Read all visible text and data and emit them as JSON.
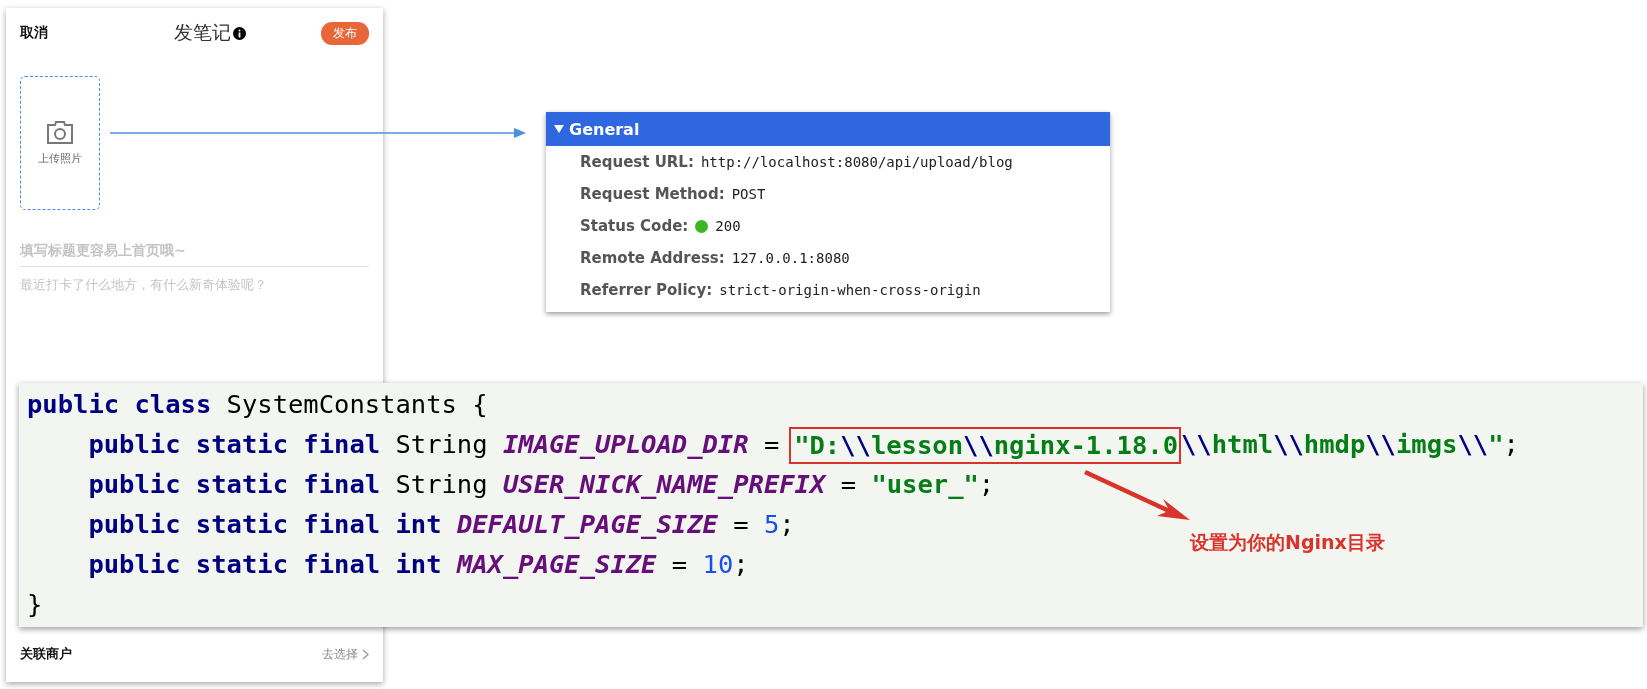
{
  "phone_form": {
    "cancel": "取消",
    "title": "发笔记",
    "publish": "发布",
    "upload": {
      "label": "上传照片"
    },
    "title_field": {
      "placeholder": "填写标题更容易上首页哦~"
    },
    "body_field": {
      "placeholder": "最近打卡了什么地方，有什么新奇体验呢？"
    },
    "merchant_row": {
      "label": "关联商户",
      "action": "去选择"
    }
  },
  "network_panel": {
    "section": {
      "title": "General",
      "expanded": true
    },
    "rows": [
      {
        "label": "Request URL:",
        "value": "http://localhost:8080/api/upload/blog"
      },
      {
        "label": "Request Method:",
        "value": "POST"
      },
      {
        "label": "Status Code:",
        "value": "200",
        "color": "#3cb521"
      },
      {
        "label": "Remote Address:",
        "value": "127.0.0.1:8080"
      },
      {
        "label": "Referrer Policy:",
        "value": "strict-origin-when-cross-origin"
      }
    ]
  },
  "code": {
    "lines": [
      {
        "indented": false,
        "tokens": [
          {
            "kind": "keyword",
            "text": "public class "
          },
          {
            "kind": "plain",
            "text": "SystemConstants {"
          }
        ]
      },
      {
        "indented": true,
        "tokens": [
          {
            "kind": "keyword",
            "text": "public static final "
          },
          {
            "kind": "plain",
            "text": "String "
          },
          {
            "kind": "constant",
            "text": "IMAGE_UPLOAD_DIR"
          },
          {
            "kind": "plain",
            "text": " = "
          },
          {
            "kind": "string",
            "text": "\"D:",
            "boxed": true
          },
          {
            "kind": "escape",
            "text": "\\\\",
            "boxed": true
          },
          {
            "kind": "string",
            "text": "lesson",
            "boxed": true
          },
          {
            "kind": "escape",
            "text": "\\\\",
            "boxed": true
          },
          {
            "kind": "string",
            "text": "nginx-1.18.0",
            "boxed": true
          },
          {
            "kind": "escape",
            "text": "\\\\"
          },
          {
            "kind": "string",
            "text": "html"
          },
          {
            "kind": "escape",
            "text": "\\\\"
          },
          {
            "kind": "string",
            "text": "hmdp"
          },
          {
            "kind": "escape",
            "text": "\\\\"
          },
          {
            "kind": "string",
            "text": "imgs"
          },
          {
            "kind": "escape",
            "text": "\\\\"
          },
          {
            "kind": "string",
            "text": "\""
          },
          {
            "kind": "plain",
            "text": ";"
          }
        ]
      },
      {
        "indented": true,
        "tokens": [
          {
            "kind": "keyword",
            "text": "public static final "
          },
          {
            "kind": "plain",
            "text": "String "
          },
          {
            "kind": "constant",
            "text": "USER_NICK_NAME_PREFIX"
          },
          {
            "kind": "plain",
            "text": " = "
          },
          {
            "kind": "string",
            "text": "\"user_\""
          },
          {
            "kind": "plain",
            "text": ";"
          }
        ]
      },
      {
        "indented": true,
        "tokens": [
          {
            "kind": "keyword",
            "text": "public static final int "
          },
          {
            "kind": "constant",
            "text": "DEFAULT_PAGE_SIZE"
          },
          {
            "kind": "plain",
            "text": " = "
          },
          {
            "kind": "number",
            "text": "5"
          },
          {
            "kind": "plain",
            "text": ";"
          }
        ]
      },
      {
        "indented": true,
        "tokens": [
          {
            "kind": "keyword",
            "text": "public static final int "
          },
          {
            "kind": "constant",
            "text": "MAX_PAGE_SIZE"
          },
          {
            "kind": "plain",
            "text": " = "
          },
          {
            "kind": "number",
            "text": "10"
          },
          {
            "kind": "plain",
            "text": ";"
          }
        ]
      },
      {
        "indented": false,
        "tokens": [
          {
            "kind": "plain",
            "text": "}"
          }
        ]
      }
    ]
  },
  "annotation": {
    "text": "设置为你的Nginx目录"
  }
}
